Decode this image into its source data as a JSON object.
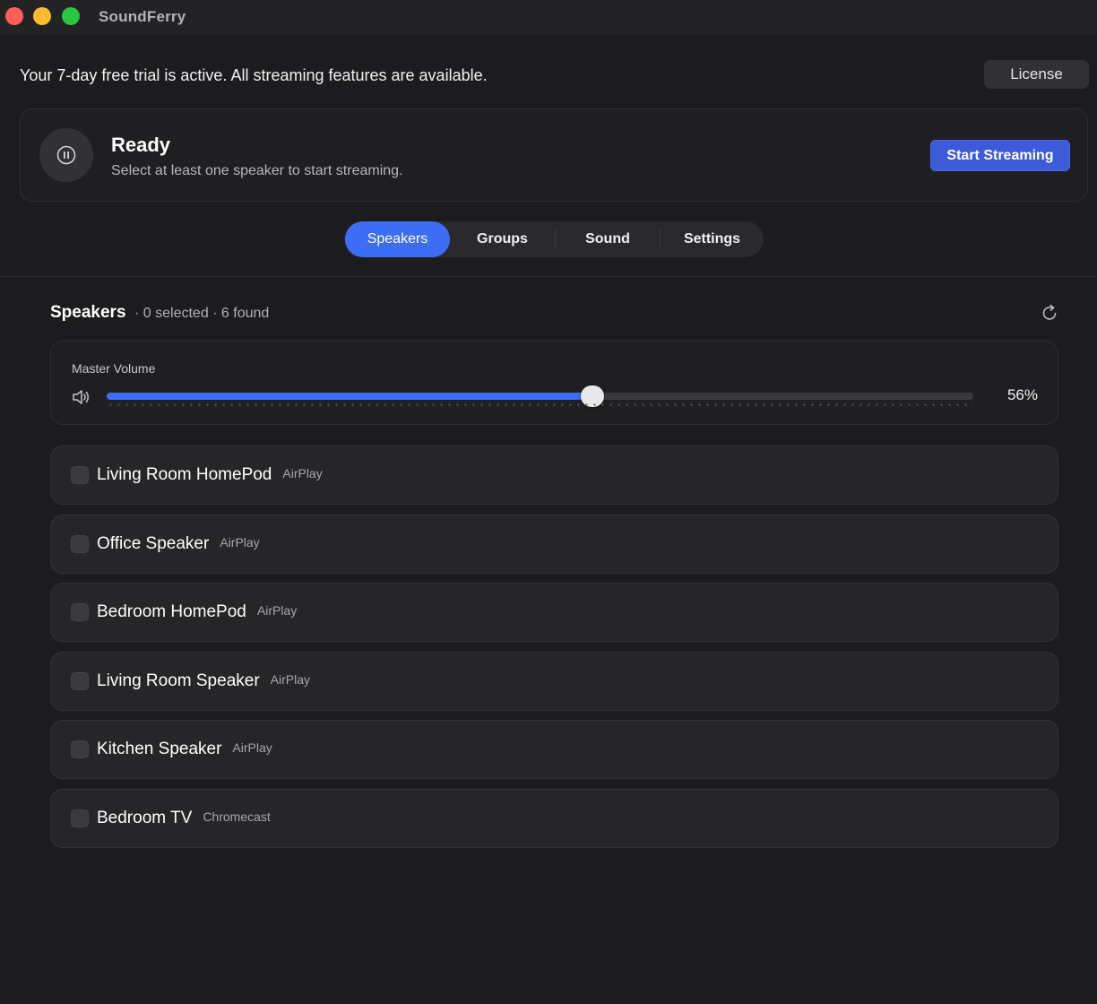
{
  "app": {
    "title": "SoundFerry"
  },
  "trial": {
    "message": "Your 7-day free trial is active. All streaming features are available.",
    "license_label": "License"
  },
  "status": {
    "icon": "pause-icon",
    "title": "Ready",
    "subtitle": "Select at least one speaker to start streaming.",
    "start_label": "Start Streaming"
  },
  "tabs": [
    {
      "label": "Speakers",
      "active": true
    },
    {
      "label": "Groups",
      "active": false
    },
    {
      "label": "Sound",
      "active": false
    },
    {
      "label": "Settings",
      "active": false
    }
  ],
  "speakers_section": {
    "title": "Speakers",
    "meta": "· 0 selected · 6 found",
    "refresh_icon": "refresh-icon"
  },
  "volume": {
    "label": "Master Volume",
    "icon": "speaker-volume-icon",
    "value": 56,
    "display": "56%"
  },
  "speakers": [
    {
      "name": "Living Room HomePod",
      "type": "AirPlay",
      "selected": false
    },
    {
      "name": "Office Speaker",
      "type": "AirPlay",
      "selected": false
    },
    {
      "name": "Bedroom HomePod",
      "type": "AirPlay",
      "selected": false
    },
    {
      "name": "Living Room Speaker",
      "type": "AirPlay",
      "selected": false
    },
    {
      "name": "Kitchen Speaker",
      "type": "AirPlay",
      "selected": false
    },
    {
      "name": "Bedroom TV",
      "type": "Chromecast",
      "selected": false
    }
  ],
  "colors": {
    "accent": "#3e6df5",
    "start_button": "#3d5bd9",
    "background": "#1c1c1e"
  }
}
